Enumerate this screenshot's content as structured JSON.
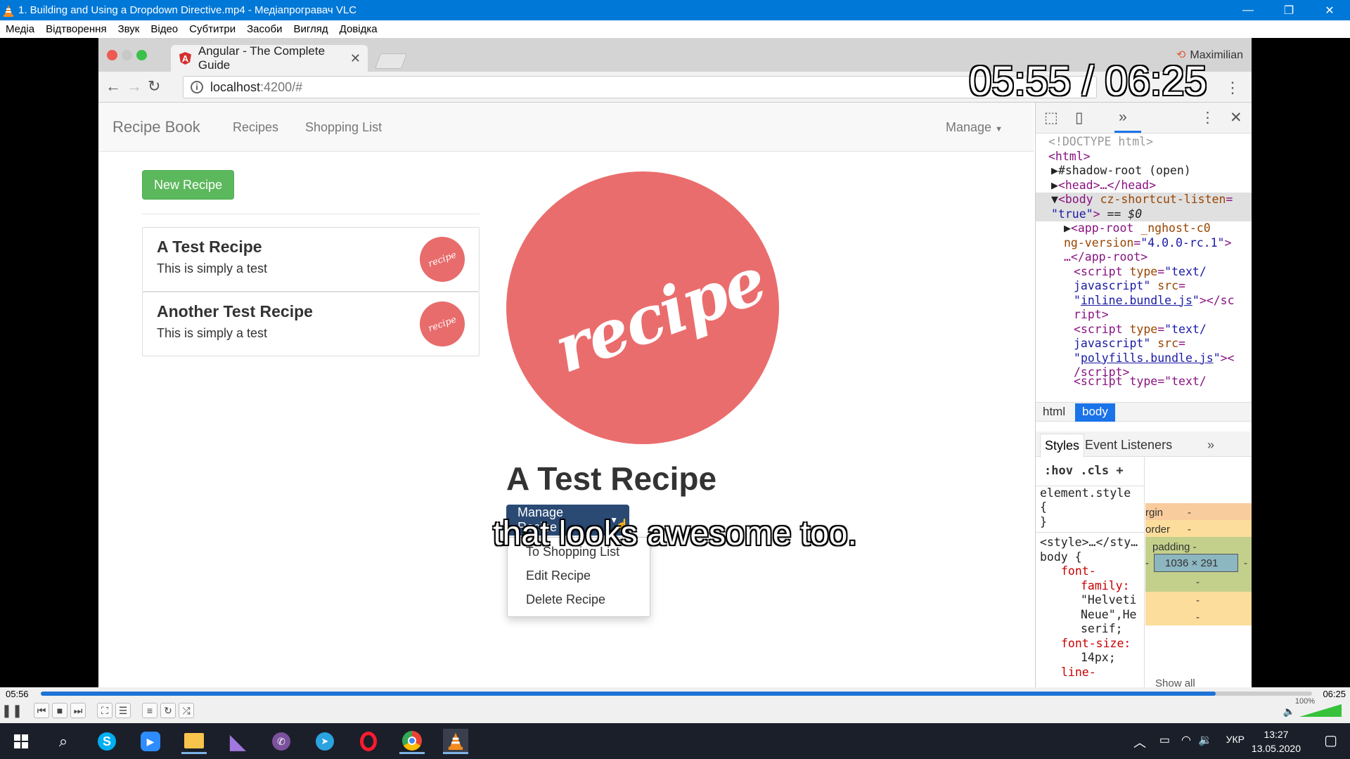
{
  "window": {
    "title": "1. Building and Using a Dropdown Directive.mp4 - Медіапрогравач VLC",
    "minimize": "—",
    "maximize": "❐",
    "close": "✕"
  },
  "menu": [
    "Медіа",
    "Відтворення",
    "Звук",
    "Відео",
    "Субтитри",
    "Засоби",
    "Вигляд",
    "Довідка"
  ],
  "browser": {
    "tab_title": "Angular - The Complete Guide",
    "tab_icon_letter": "A",
    "profile": "Maximilian",
    "url_host": "localhost",
    "url_rest": ":4200/#"
  },
  "app": {
    "brand": "Recipe Book",
    "nav_recipes": "Recipes",
    "nav_shopping": "Shopping List",
    "nav_manage": "Manage",
    "new_recipe": "New Recipe",
    "recipes": [
      {
        "name": "A Test Recipe",
        "description": "This is simply a test",
        "thumb_text": "recipe"
      },
      {
        "name": "Another Test Recipe",
        "description": "This is simply a test",
        "thumb_text": "recipe"
      }
    ],
    "detail": {
      "image_text": "recipe",
      "name": "A Test Recipe",
      "manage_button": "Manage Recipe",
      "dropdown": [
        "To Shopping List",
        "Edit Recipe",
        "Delete Recipe"
      ]
    }
  },
  "devtools": {
    "dom": {
      "doctype": "<!DOCTYPE html>",
      "html_open": "<html>",
      "shadow": "#shadow-root (open)",
      "head": "<head>…</head>",
      "body_tag": "body",
      "body_attr": "cz-shortcut-listen",
      "body_val": "\"true\"",
      "body_eq": "== $0",
      "approot_tag": "app-root",
      "approot_attr": "_nghost-c0",
      "approot_attr2": "ng-version",
      "approot_val2": "\"4.0.0-rc.1\"",
      "approot_close": "…</app-root>",
      "script_tag": "script",
      "script_type_attr": "type",
      "script_type_val1": "\"text/",
      "script_type_val2": "javascript\"",
      "script_src_attr": "src",
      "src1": "inline.bundle.js",
      "src2": "polyfills.bundle.js",
      "close_script_a": "></sc",
      "close_script_b": "ript>",
      "close_script_c": "><",
      "close_script_d": "/script>",
      "partial": "<script type=\"text/"
    },
    "crumbs": [
      "html",
      "body"
    ],
    "tabs": [
      "Styles",
      "Event Listeners"
    ],
    "filter": [
      ":hov",
      ".cls",
      "+"
    ],
    "styles": {
      "element_style": "element.style",
      "open_brace": "{",
      "close_brace": "}",
      "style_rule": "<style>…</sty…",
      "body_sel": "body {",
      "ff_prop": "font-",
      "ff_prop2": "family:",
      "ff_val1": "\"Helveti",
      "ff_val2": "Neue\",He",
      "ff_val3": "serif;",
      "fs_prop": "font-size:",
      "fs_val": "14px;",
      "lh_prop": "line-"
    },
    "boxmodel": {
      "margin": "rgin",
      "border": "order",
      "padding": "padding -",
      "dims": "1036 × 291",
      "dash": "-",
      "show_all": "Show all"
    }
  },
  "player": {
    "osd_time": "05:55 / 06:25",
    "subtitle": "that looks awesome too.",
    "elapsed": "05:56",
    "total": "06:25",
    "progress": 0.924,
    "volume_label": "100%"
  },
  "taskbar": {
    "time": "13:27",
    "date": "13.05.2020",
    "language": "УКР"
  },
  "colors": {
    "titlebar": "#0078d7",
    "recipe_red": "#ea6d6d",
    "success_green": "#5cb85c",
    "manage_blue": "#2a4a74",
    "devtools_blue": "#1a73e8"
  }
}
